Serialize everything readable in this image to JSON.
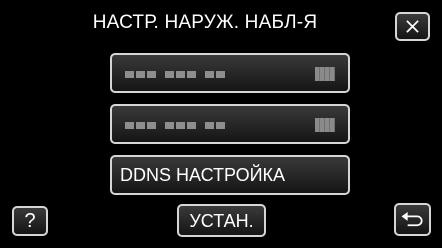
{
  "header": {
    "title": "НАСТР. НАРУЖ. НАБЛ-Я"
  },
  "buttons": {
    "close_icon": "close-icon",
    "ddns_label": "DDNS НАСТРОЙКА",
    "help_label": "?",
    "set_label": "УСТАН.",
    "back_icon": "return-icon"
  },
  "list": {
    "row1_icon": "obscured-value-icon",
    "row2_icon": "obscured-value-icon"
  },
  "colors": {
    "background": "#000000",
    "button_border": "#d6d6d6",
    "text": "#ffffff",
    "placeholder_gray": "#8e8e8e"
  }
}
